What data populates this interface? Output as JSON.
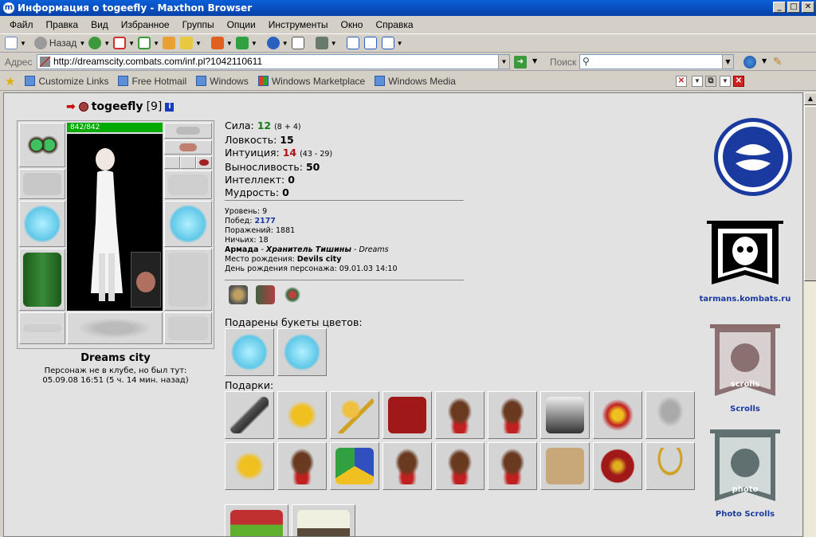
{
  "window": {
    "title": "Информация о togeefly - Maxthon Browser",
    "app_icon": "m",
    "min": "_",
    "max": "□",
    "close": "✕"
  },
  "menu": [
    "Файл",
    "Правка",
    "Вид",
    "Избранное",
    "Группы",
    "Опции",
    "Инструменты",
    "Окно",
    "Справка"
  ],
  "toolbar": {
    "back_label": "Назад"
  },
  "address": {
    "label": "Адрес",
    "url": "http://dreamscity.combats.com/inf.pl?1042110611",
    "search_label": "Поиск",
    "search_value": ""
  },
  "links": [
    "Customize Links",
    "Free Hotmail",
    "Windows",
    "Windows Marketplace",
    "Windows Media"
  ],
  "character": {
    "nick": "togeefly",
    "level": "[9]",
    "hp": "842/842",
    "city": "Dreams city",
    "note_line1": "Персонаж не в клубе, но был тут:",
    "note_line2": "05.09.08 16:51 (5 ч. 14 мин. назад)"
  },
  "stats": {
    "strength": {
      "label": "Сила:",
      "value": "12",
      "mod": "(8 + 4)",
      "color": "#1a7a1a"
    },
    "agility": {
      "label": "Ловкость:",
      "value": "15"
    },
    "intuition": {
      "label": "Интуиция:",
      "value": "14",
      "mod": "(43 - 29)",
      "color": "#b01010"
    },
    "endurance": {
      "label": "Выносливость:",
      "value": "50"
    },
    "intellect": {
      "label": "Интеллект:",
      "value": "0"
    },
    "wisdom": {
      "label": "Мудрость:",
      "value": "0"
    }
  },
  "info": {
    "level": {
      "label": "Уровень:",
      "value": "9"
    },
    "wins": {
      "label": "Побед:",
      "value": "2177"
    },
    "losses": {
      "label": "Поражений:",
      "value": "1881"
    },
    "draws": {
      "label": "Ничьих:",
      "value": "18"
    },
    "clan": {
      "name": "Армада",
      "sep": "-",
      "rank": "Хранитель Тишины",
      "sep2": "-",
      "city": "Dreams"
    },
    "birthplace": {
      "label": "Место рождения:",
      "value": "Devils city"
    },
    "birthday": {
      "label": "День рождения персонажа:",
      "value": "09.01.03 14:10"
    }
  },
  "flowers_heading": "Подарены букеты цветов:",
  "gifts_heading": "Подарки:",
  "banners": {
    "tarmans": "tarmans.kombats.ru",
    "scrolls": "Scrolls",
    "scrolls_art": "scrolls",
    "photo": "Photo Scrolls",
    "photo_art": "photo"
  },
  "colors": {
    "accent_blue": "#1a3aa0",
    "title_blue": "#0a5fd8",
    "hp_green": "#00aa00"
  }
}
